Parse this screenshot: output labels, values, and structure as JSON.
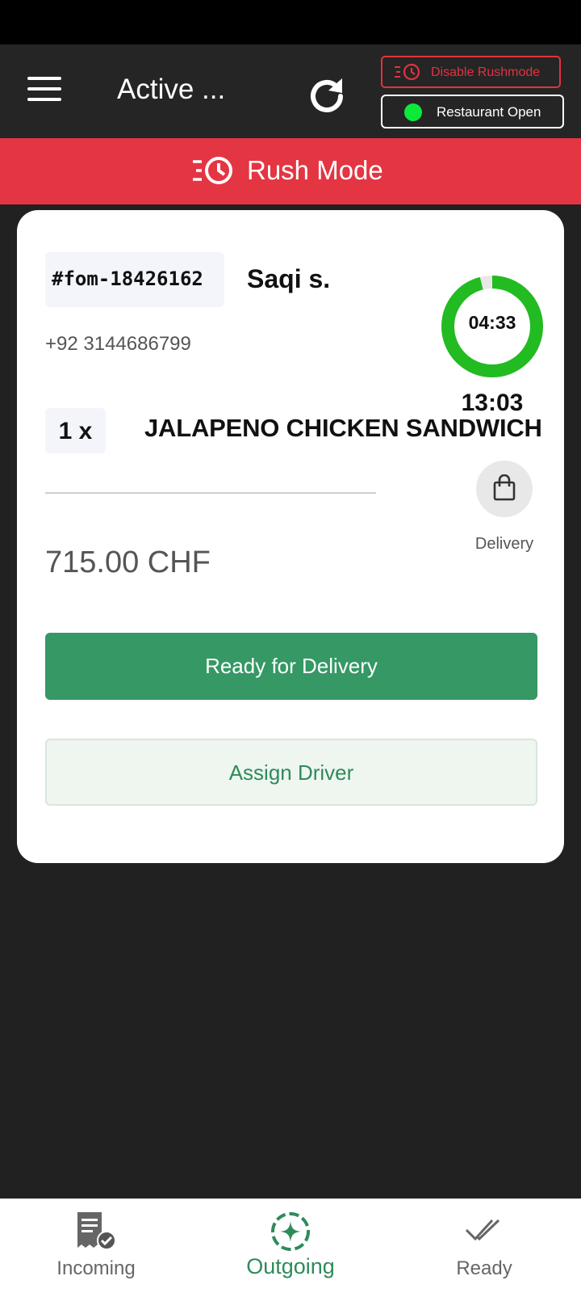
{
  "header": {
    "title": "Active ...",
    "disable_rushmode_label": "Disable Rushmode",
    "restaurant_status_label": "Restaurant Open",
    "restaurant_status_color": "#0be93a"
  },
  "rush_banner": {
    "label": "Rush Mode",
    "color": "#e43542"
  },
  "order": {
    "id": "#fom-18426162",
    "customer_name": "Saqi s.",
    "phone": "+92 3144686799",
    "timer_remaining": "04:33",
    "timer_total": "13:03",
    "timer_progress": 0.96,
    "items": [
      {
        "quantity": "1 x",
        "name": "JALAPENO CHICKEN SANDWICH"
      }
    ],
    "order_type": "Delivery",
    "order_type_icon": "shopping-bag-icon",
    "total": "715.00 CHF",
    "primary_action": "Ready for Delivery",
    "secondary_action": "Assign Driver"
  },
  "bottom_nav": {
    "items": [
      {
        "label": "Incoming",
        "icon": "receipt-check-icon"
      },
      {
        "label": "Outgoing",
        "icon": "sparkle-badge-icon",
        "active": true
      },
      {
        "label": "Ready",
        "icon": "double-check-icon"
      }
    ],
    "active_color": "#2f8a5b"
  }
}
